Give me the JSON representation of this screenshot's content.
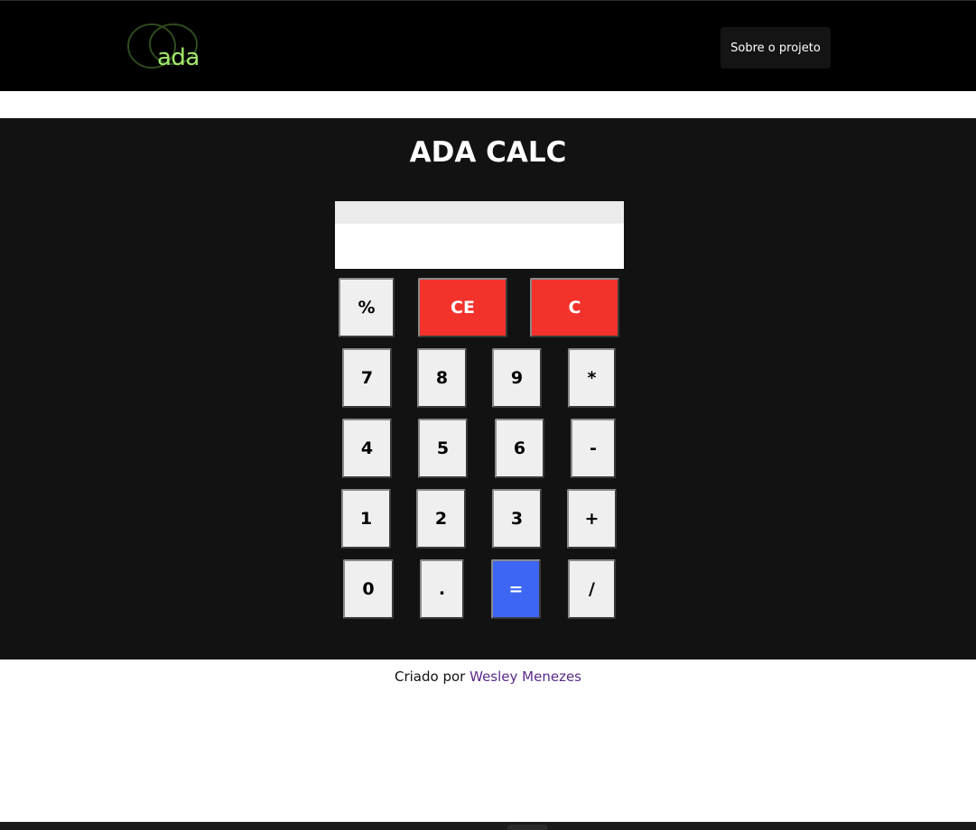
{
  "header": {
    "logo_text": "ada",
    "nav_button_label": "Sobre o projeto",
    "logo_color": "#a3e86b"
  },
  "calculator": {
    "title": "ADA CALC",
    "display": {
      "previous": "",
      "current": ""
    },
    "keys": {
      "percent": "%",
      "ce": "CE",
      "c": "C",
      "seven": "7",
      "eight": "8",
      "nine": "9",
      "multiply": "*",
      "four": "4",
      "five": "5",
      "six": "6",
      "minus": "-",
      "one": "1",
      "two": "2",
      "three": "3",
      "plus": "+",
      "zero": "0",
      "dot": ".",
      "equals": "=",
      "divide": "/"
    },
    "colors": {
      "clear": "#f3322c",
      "equals": "#3e66f5",
      "key": "#efefef",
      "panel": "#121212"
    }
  },
  "footer": {
    "credit_prefix": "Criado por",
    "author": "Wesley Menezes"
  }
}
